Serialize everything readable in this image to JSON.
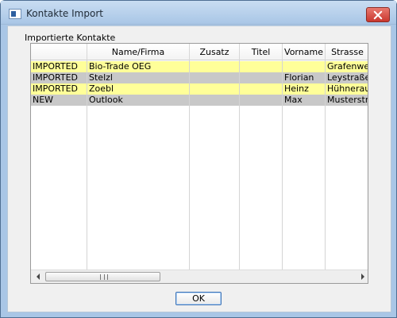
{
  "window": {
    "title": "Kontakte Import"
  },
  "group_label": "Importierte Kontakte",
  "table": {
    "columns": [
      "",
      "Name/Firma",
      "Zusatz",
      "Titel",
      "Vorname",
      "Strasse"
    ],
    "rows": [
      {
        "status": "IMPORTED",
        "name": "Bio-Trade OEG",
        "zusatz": "",
        "titel": "",
        "vorname": "",
        "strasse": "Grafenweg",
        "color": "#ffff99"
      },
      {
        "status": "IMPORTED",
        "name": "Stelzl",
        "zusatz": "",
        "titel": "",
        "vorname": "Florian",
        "strasse": "Leystraße",
        "color": "#c8c8c8"
      },
      {
        "status": "IMPORTED",
        "name": "Zoebl",
        "zusatz": "",
        "titel": "",
        "vorname": "Heinz",
        "strasse": "Hühnerau",
        "color": "#ffff99"
      },
      {
        "status": "NEW",
        "name": "Outlook",
        "zusatz": "",
        "titel": "",
        "vorname": "Max",
        "strasse": "Musterstras",
        "color": "#c8c8c8"
      }
    ]
  },
  "scrollbar": {
    "thumb_label": "III"
  },
  "buttons": {
    "ok": "OK"
  },
  "colors": {
    "imported_row": "#ffff99",
    "new_row": "#c8c8c8",
    "title_bar": "#a9c6e6"
  },
  "icons": {
    "app": "app-window-icon",
    "close": "close-icon"
  }
}
